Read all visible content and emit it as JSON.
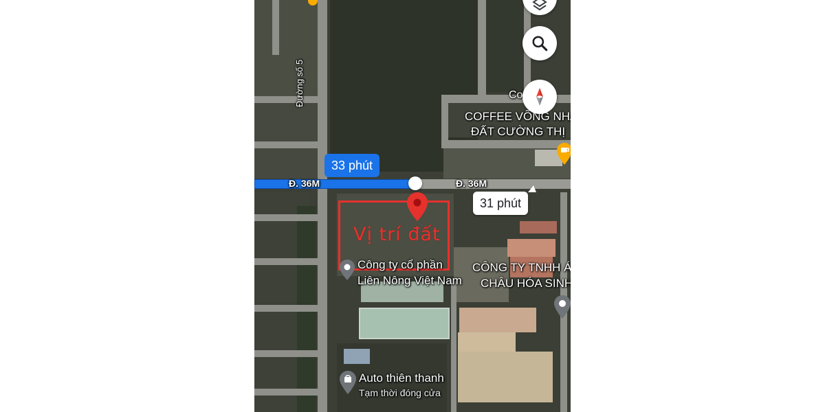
{
  "map": {
    "view": "satellite",
    "route_times": {
      "primary": "33 phút",
      "alternate": "31 phút"
    },
    "roads": {
      "main_road_left": "Đ. 36M",
      "main_road_right": "Đ. 36M",
      "side_road": "Đường số 5"
    },
    "poi_labels": {
      "coffee_top": "Coffee Lạ",
      "coffee_line1": "COFFEE VÕNG NHA",
      "coffee_line2": "ĐẤT CƯỜNG THỊ",
      "company_lnvn_line1": "Công ty cổ phần",
      "company_lnvn_line2": "Liên Nông Việt Nam",
      "company_tnhh_line1": "CÔNG TY TNHH Á",
      "company_tnhh_line2": "CHÂU HÓA SINH",
      "auto_name": "Auto thiên thanh",
      "auto_status": "Tạm thời đóng cửa"
    },
    "annotation": {
      "text": "Vị trí đất",
      "color": "#e5322d"
    },
    "colors": {
      "route_primary": "#1a73e8",
      "route_alternate": "#8ab4f8",
      "pin_red": "#e5322d",
      "poi_orange": "#f9ab00",
      "poi_gray": "#70757a"
    },
    "controls": {
      "layers_icon": "layers-icon",
      "search_icon": "search-icon",
      "compass_icon": "compass-icon"
    }
  }
}
